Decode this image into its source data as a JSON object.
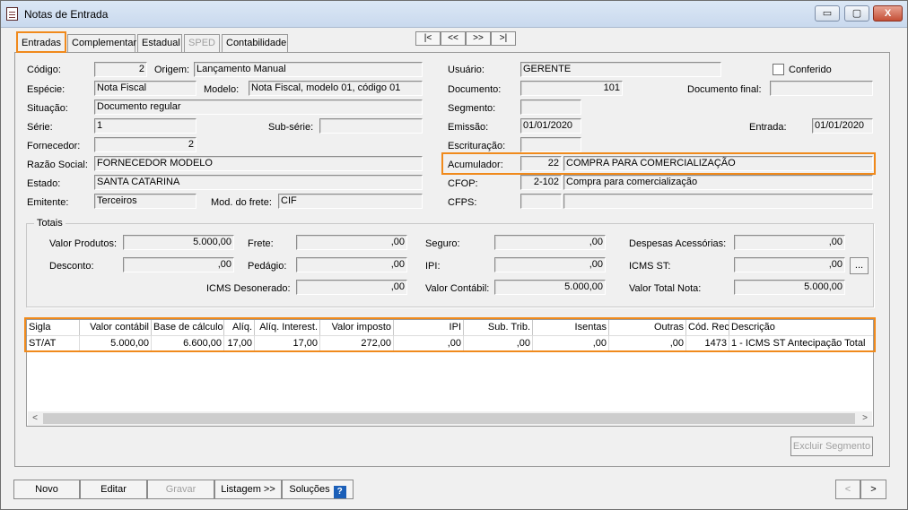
{
  "window": {
    "title": "Notas de Entrada",
    "icon": "document-icon",
    "controls": {
      "minimize": "▭",
      "restore": "▢",
      "close": "X"
    }
  },
  "tabs": [
    "Entradas",
    "Complementar",
    "Estadual",
    "SPED",
    "Contabilidade"
  ],
  "nav": [
    "|<",
    "<<",
    ">>",
    ">|"
  ],
  "form": {
    "codigo": {
      "label": "Código:",
      "value": "2"
    },
    "origem": {
      "label": "Origem:",
      "value": "Lançamento Manual"
    },
    "especie": {
      "label": "Espécie:",
      "value": "Nota Fiscal"
    },
    "modelo": {
      "label": "Modelo:",
      "value": "Nota Fiscal, modelo 01, código 01"
    },
    "situacao": {
      "label": "Situação:",
      "value": "Documento regular"
    },
    "serie": {
      "label": "Série:",
      "value": "1"
    },
    "subserie": {
      "label": "Sub-série:",
      "value": ""
    },
    "fornecedor": {
      "label": "Fornecedor:",
      "value": "2"
    },
    "razao_social": {
      "label": "Razão Social:",
      "value": "FORNECEDOR MODELO"
    },
    "estado": {
      "label": "Estado:",
      "value": "SANTA CATARINA"
    },
    "emitente": {
      "label": "Emitente:",
      "value": "Terceiros"
    },
    "mod_frete": {
      "label": "Mod. do frete:",
      "value": "CIF"
    },
    "usuario": {
      "label": "Usuário:",
      "value": "GERENTE"
    },
    "conferido": {
      "label": "Conferido",
      "checked": false
    },
    "documento": {
      "label": "Documento:",
      "value": "101"
    },
    "documento_final": {
      "label": "Documento final:",
      "value": ""
    },
    "segmento": {
      "label": "Segmento:",
      "value": ""
    },
    "emissao": {
      "label": "Emissão:",
      "value": "01/01/2020"
    },
    "entrada": {
      "label": "Entrada:",
      "value": "01/01/2020"
    },
    "escrituracao": {
      "label": "Escrituração:",
      "value": ""
    },
    "acumulador": {
      "label": "Acumulador:",
      "code": "22",
      "desc": "COMPRA PARA COMERCIALIZAÇÃO"
    },
    "cfop": {
      "label": "CFOP:",
      "code": "2-102",
      "desc": "Compra para comercialização"
    },
    "cfps": {
      "label": "CFPS:",
      "code": "",
      "desc": ""
    }
  },
  "totais": {
    "title": "Totais",
    "valor_produtos": {
      "label": "Valor Produtos:",
      "value": "5.000,00"
    },
    "frete": {
      "label": "Frete:",
      "value": ",00"
    },
    "seguro": {
      "label": "Seguro:",
      "value": ",00"
    },
    "despesas": {
      "label": "Despesas Acessórias:",
      "value": ",00"
    },
    "desconto": {
      "label": "Desconto:",
      "value": ",00"
    },
    "pedagio": {
      "label": "Pedágio:",
      "value": ",00"
    },
    "ipi": {
      "label": "IPI:",
      "value": ",00"
    },
    "icms_st": {
      "label": "ICMS ST:",
      "value": ",00",
      "button": "..."
    },
    "icms_desonerado": {
      "label": "ICMS Desonerado:",
      "value": ",00"
    },
    "valor_contabil": {
      "label": "Valor Contábil:",
      "value": "5.000,00"
    },
    "valor_total": {
      "label": "Valor Total Nota:",
      "value": "5.000,00"
    }
  },
  "grid": {
    "columns": [
      "Sigla",
      "Valor contábil",
      "Base de cálculo",
      "Alíq.",
      "Alíq. Interest.",
      "Valor imposto",
      "IPI",
      "Sub. Trib.",
      "Isentas",
      "Outras",
      "Cód. Rec.",
      "Descrição"
    ],
    "rows": [
      [
        "ST/AT",
        "5.000,00",
        "6.600,00",
        "17,00",
        "17,00",
        "272,00",
        ",00",
        ",00",
        ",00",
        ",00",
        "1473",
        "1 - ICMS ST Antecipação Total"
      ]
    ]
  },
  "scroll_arrows": {
    "left": "<",
    "right": ">"
  },
  "buttons": {
    "excluir_segmento": "Excluir Segmento",
    "novo": "Novo",
    "editar": "Editar",
    "gravar": "Gravar",
    "listagem": "Listagem >>",
    "solucoes": "Soluções",
    "solucoes_help": "?",
    "prev": "<",
    "next": ">"
  }
}
